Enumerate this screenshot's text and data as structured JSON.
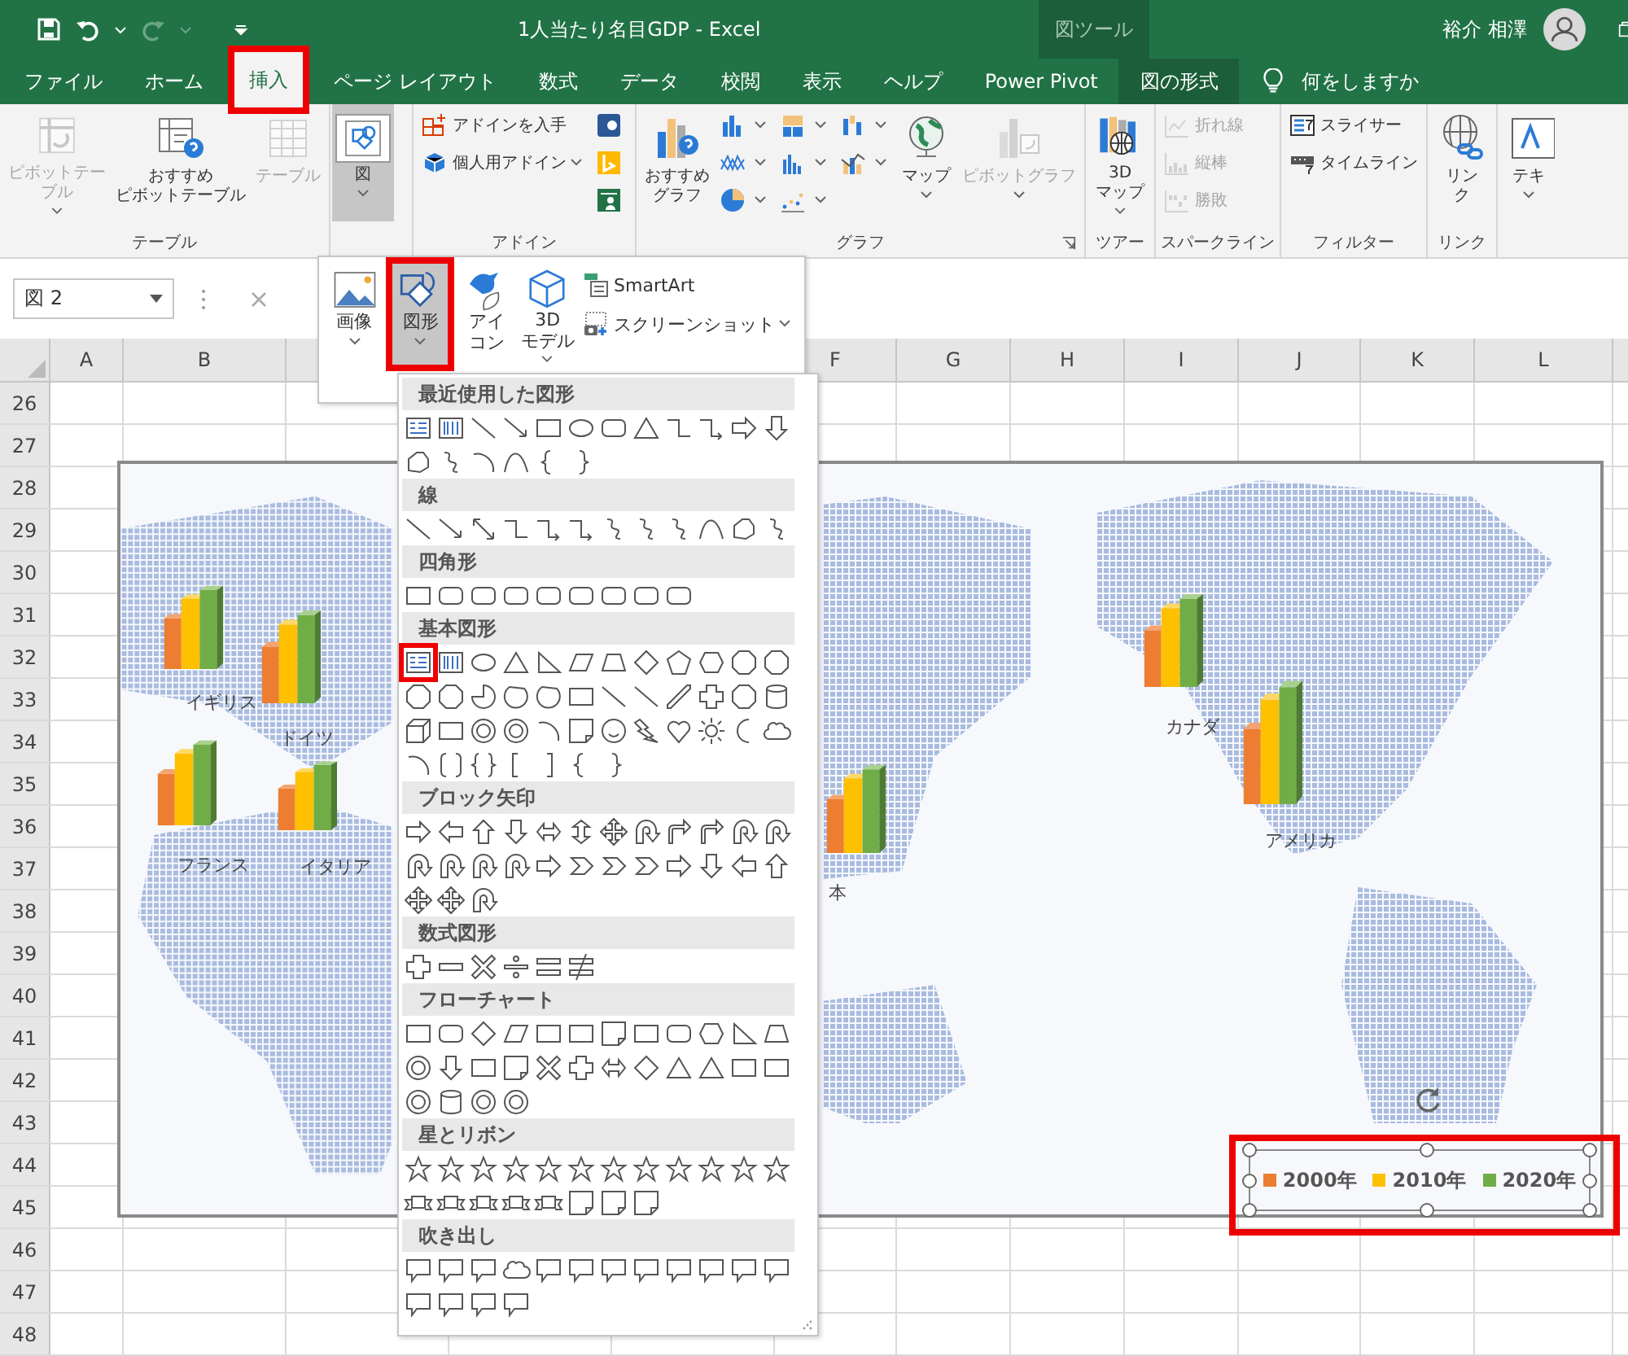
{
  "title_bar": {
    "title": "1人当たり名目GDP  -  Excel",
    "context_label": "図ツール",
    "user_name": "裕介 相澤"
  },
  "tabs": [
    {
      "label": "ファイル",
      "selected": false,
      "highlighted": false,
      "kind": "normal"
    },
    {
      "label": "ホーム",
      "selected": false,
      "highlighted": false,
      "kind": "normal"
    },
    {
      "label": "挿入",
      "selected": true,
      "highlighted": true,
      "kind": "normal"
    },
    {
      "label": "ページ レイアウト",
      "selected": false,
      "highlighted": false,
      "kind": "normal"
    },
    {
      "label": "数式",
      "selected": false,
      "highlighted": false,
      "kind": "normal"
    },
    {
      "label": "データ",
      "selected": false,
      "highlighted": false,
      "kind": "normal"
    },
    {
      "label": "校閲",
      "selected": false,
      "highlighted": false,
      "kind": "normal"
    },
    {
      "label": "表示",
      "selected": false,
      "highlighted": false,
      "kind": "normal"
    },
    {
      "label": "ヘルプ",
      "selected": false,
      "highlighted": false,
      "kind": "normal"
    },
    {
      "label": "Power Pivot",
      "selected": false,
      "highlighted": false,
      "kind": "normal"
    },
    {
      "label": "図の形式",
      "selected": false,
      "highlighted": false,
      "kind": "contextual"
    }
  ],
  "tell_me": {
    "placeholder": "何をしますか"
  },
  "ribbon": {
    "groups": [
      {
        "label": "テーブル",
        "launcher": false,
        "buttons": [
          {
            "lines": [
              "ピボットテー",
              "ブル"
            ],
            "kind": "large",
            "disabled": true,
            "pressed": false,
            "dropdown": true
          },
          {
            "lines": [
              "おすすめ",
              "ピボットテーブル"
            ],
            "kind": "large",
            "disabled": false,
            "pressed": false,
            "dropdown": false
          },
          {
            "lines": [
              "テーブル"
            ],
            "kind": "large",
            "disabled": true,
            "pressed": false,
            "dropdown": false
          }
        ]
      },
      {
        "buttons": [
          {
            "lines": [
              "図"
            ],
            "kind": "large",
            "disabled": false,
            "pressed": true,
            "dropdown": true
          }
        ]
      },
      {
        "label": "アドイン",
        "launcher": false,
        "buttons": [
          {
            "label": "アドインを入手",
            "kind": "small",
            "disabled": false,
            "pressed": false,
            "dropdown": false
          },
          {
            "label": "個人用アドイン",
            "kind": "small",
            "disabled": false,
            "pressed": false,
            "dropdown": true
          },
          {
            "kind": "icon",
            "disabled": false,
            "pressed": false,
            "dropdown": false
          },
          {
            "kind": "icon",
            "disabled": false,
            "pressed": false,
            "dropdown": false
          },
          {
            "kind": "icon",
            "disabled": false,
            "pressed": false,
            "dropdown": false
          }
        ]
      },
      {
        "label": "グラフ",
        "launcher": true,
        "buttons": [
          {
            "lines": [
              "おすすめ",
              "グラフ"
            ],
            "kind": "large",
            "disabled": false,
            "pressed": false,
            "dropdown": false
          },
          {
            "kind": "icon",
            "disabled": false,
            "pressed": false,
            "dropdown": true
          },
          {
            "kind": "icon",
            "disabled": false,
            "pressed": false,
            "dropdown": true
          },
          {
            "kind": "icon",
            "disabled": false,
            "pressed": false,
            "dropdown": true
          },
          {
            "kind": "icon",
            "disabled": false,
            "pressed": false,
            "dropdown": true
          },
          {
            "kind": "icon",
            "disabled": false,
            "pressed": false,
            "dropdown": true
          },
          {
            "kind": "icon",
            "disabled": false,
            "pressed": false,
            "dropdown": true
          },
          {
            "kind": "icon",
            "disabled": false,
            "pressed": false,
            "dropdown": true
          },
          {
            "kind": "icon",
            "disabled": false,
            "pressed": false,
            "dropdown": true
          },
          {
            "lines": [
              "マップ"
            ],
            "kind": "large",
            "disabled": false,
            "pressed": false,
            "dropdown": true
          },
          {
            "lines": [
              "ピボットグラフ"
            ],
            "kind": "large",
            "disabled": true,
            "pressed": false,
            "dropdown": true
          }
        ]
      },
      {
        "label": "ツアー",
        "launcher": false,
        "buttons": [
          {
            "lines": [
              "3D",
              "マップ"
            ],
            "kind": "large",
            "disabled": false,
            "pressed": false,
            "dropdown": true
          }
        ]
      },
      {
        "label": "スパークライン",
        "launcher": false,
        "buttons": [
          {
            "label": "折れ線",
            "kind": "small",
            "disabled": true,
            "pressed": false,
            "dropdown": false
          },
          {
            "label": "縦棒",
            "kind": "small",
            "disabled": true,
            "pressed": false,
            "dropdown": false
          },
          {
            "label": "勝敗",
            "kind": "small",
            "disabled": true,
            "pressed": false,
            "dropdown": false
          }
        ]
      },
      {
        "label": "フィルター",
        "launcher": false,
        "buttons": [
          {
            "label": "スライサー",
            "kind": "small",
            "disabled": false,
            "pressed": false,
            "dropdown": false
          },
          {
            "label": "タイムライン",
            "kind": "small",
            "disabled": false,
            "pressed": false,
            "dropdown": false
          }
        ]
      },
      {
        "label": "リンク",
        "launcher": false,
        "buttons": [
          {
            "lines": [
              "リン",
              "ク"
            ],
            "kind": "large",
            "disabled": false,
            "pressed": false,
            "dropdown": false
          }
        ]
      },
      {
        "buttons": [
          {
            "lines": [
              "テキ"
            ],
            "kind": "large",
            "disabled": false,
            "pressed": false,
            "dropdown": true
          }
        ]
      }
    ]
  },
  "formula_bar": {
    "name_box": "図 2"
  },
  "sheet": {
    "columns": [
      "A",
      "B",
      "F",
      "G",
      "H",
      "I",
      "J",
      "K",
      "L"
    ],
    "rows": [
      "26",
      "27",
      "28",
      "29",
      "30",
      "31",
      "32",
      "33",
      "34",
      "35",
      "36",
      "37",
      "38",
      "39",
      "40",
      "41",
      "42",
      "43",
      "44",
      "45",
      "46",
      "47",
      "48"
    ]
  },
  "map": {
    "countries": [
      {
        "label": "イギリス"
      },
      {
        "label": "ドイツ"
      },
      {
        "label": "フランス"
      },
      {
        "label": "イタリア"
      },
      {
        "label": "本"
      },
      {
        "label": "カナダ"
      },
      {
        "label": "アメリカ"
      }
    ],
    "legend": {
      "selected": true,
      "highlighted": true,
      "items": [
        {
          "label": "2000年",
          "color": "#ed7d31"
        },
        {
          "label": "2010年",
          "color": "#ffc000"
        },
        {
          "label": "2020年",
          "color": "#70ad47"
        }
      ]
    }
  },
  "picture_menu": {
    "items": [
      {
        "lines": [
          "画像"
        ],
        "kind": "large",
        "selected": false,
        "highlighted": false,
        "dropdown": true
      },
      {
        "lines": [
          "図形"
        ],
        "kind": "large",
        "selected": true,
        "highlighted": true,
        "dropdown": true
      },
      {
        "lines": [
          "アイ",
          "コン"
        ],
        "kind": "large",
        "selected": false,
        "highlighted": false,
        "dropdown": false
      },
      {
        "lines": [
          "3D",
          "モデル"
        ],
        "kind": "large",
        "selected": false,
        "highlighted": false,
        "dropdown": true
      },
      {
        "label": "SmartArt",
        "kind": "small",
        "selected": false,
        "highlighted": false,
        "dropdown": false
      },
      {
        "label": "スクリーンショット",
        "kind": "small",
        "selected": false,
        "highlighted": false,
        "dropdown": true
      }
    ]
  },
  "shape_gallery": {
    "sections": [
      {
        "title": "最近使用した図形",
        "highlight_first": false
      },
      {
        "title": "線",
        "highlight_first": false
      },
      {
        "title": "四角形",
        "highlight_first": false
      },
      {
        "title": "基本図形",
        "highlight_first": true
      },
      {
        "title": "ブロック矢印",
        "highlight_first": false
      },
      {
        "title": "数式図形",
        "highlight_first": false
      },
      {
        "title": "フローチャート",
        "highlight_first": false
      },
      {
        "title": "星とリボン",
        "highlight_first": false
      },
      {
        "title": "吹き出し",
        "highlight_first": false
      }
    ]
  }
}
